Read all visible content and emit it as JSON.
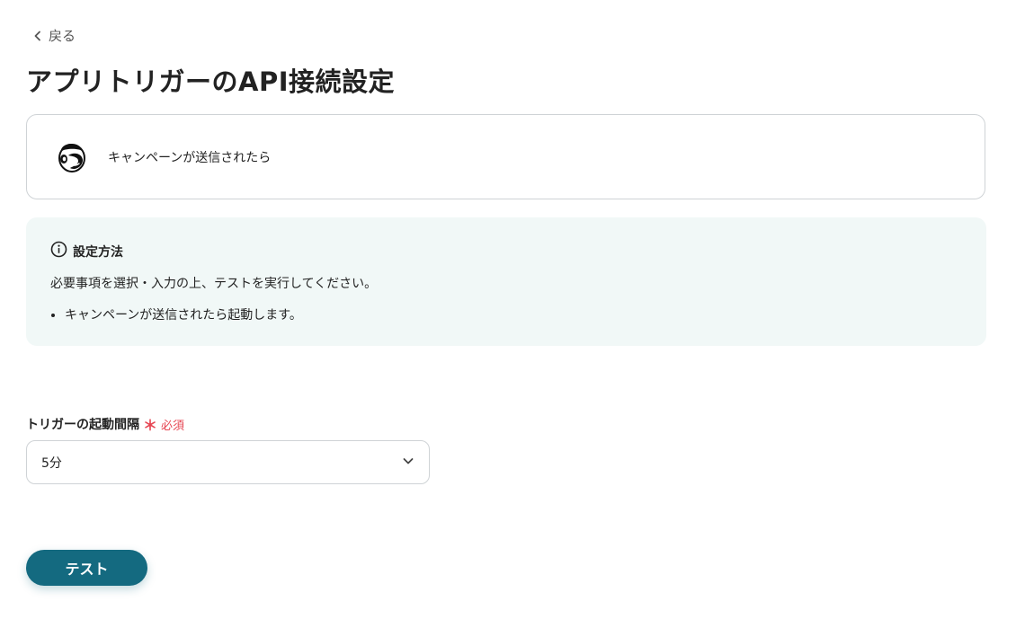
{
  "nav": {
    "back_label": "戻る"
  },
  "page": {
    "title": "アプリトリガーのAPI接続設定"
  },
  "app_card": {
    "icon": "mailchimp-logo-icon",
    "event_label": "キャンペーンが送信されたら"
  },
  "info": {
    "icon": "info-circle-icon",
    "heading": "設定方法",
    "description": "必要事項を選択・入力の上、テストを実行してください。",
    "items": [
      "キャンペーンが送信されたら起動します。"
    ]
  },
  "interval_field": {
    "label": "トリガーの起動間隔",
    "required_mark": "＊",
    "required_text": "必須",
    "selected_value": "5分"
  },
  "actions": {
    "test_label": "テスト"
  },
  "colors": {
    "primary": "#146a80",
    "required": "#e64552",
    "info_background": "#f1f8f7",
    "border": "#cfd3d6"
  }
}
